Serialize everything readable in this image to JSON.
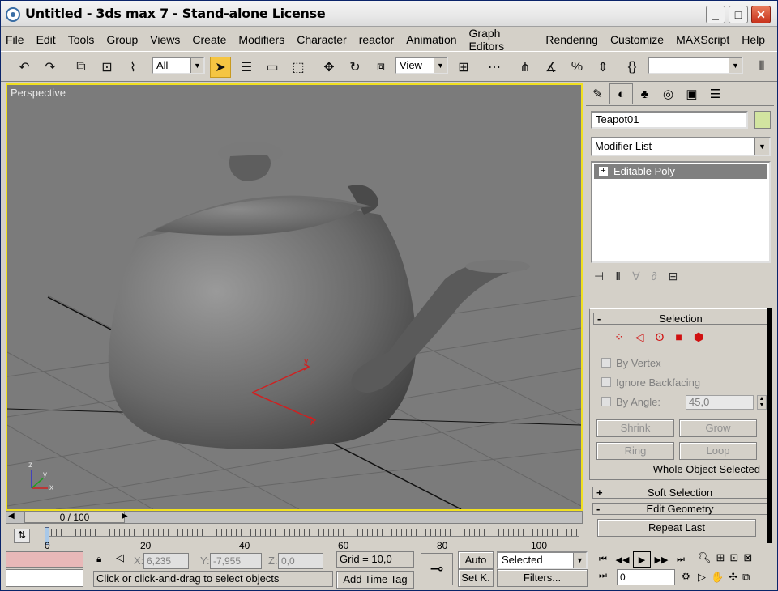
{
  "window": {
    "title": "Untitled - 3ds max 7  - Stand-alone License",
    "minimize": "_",
    "maximize": "□",
    "close": "✕"
  },
  "menu": [
    "File",
    "Edit",
    "Tools",
    "Group",
    "Views",
    "Create",
    "Modifiers",
    "Character",
    "reactor",
    "Animation",
    "Graph Editors",
    "Rendering",
    "Customize",
    "MAXScript",
    "Help"
  ],
  "toolbar": {
    "filter_value": "All",
    "coord_value": "View",
    "named_selection_value": ""
  },
  "viewport": {
    "label": "Perspective",
    "axis_x": "x",
    "axis_y": "y",
    "axis_z": "z"
  },
  "command_panel": {
    "object_name": "Teapot01",
    "object_color": "#d2e4a0",
    "modifier_list": "Modifier List",
    "stack_item": "Editable Poly",
    "selection": {
      "header": "Selection",
      "by_vertex": "By Vertex",
      "ignore_backfacing": "Ignore Backfacing",
      "by_angle": "By Angle:",
      "angle_value": "45,0",
      "shrink": "Shrink",
      "grow": "Grow",
      "ring": "Ring",
      "loop": "Loop",
      "status": "Whole Object Selected"
    },
    "soft_selection": "Soft Selection",
    "edit_geometry": "Edit Geometry",
    "repeat_last": "Repeat Last"
  },
  "timeline": {
    "slider": "0 / 100",
    "ticks": [
      "0",
      "20",
      "40",
      "60",
      "80",
      "100"
    ]
  },
  "status": {
    "x_label": "X:",
    "x_value": "6,235",
    "y_label": "Y:",
    "y_value": "-7,955",
    "z_label": "Z:",
    "z_value": "0,0",
    "grid": "Grid = 10,0",
    "prompt": "Click or click-and-drag to select objects",
    "add_time_tag": "Add Time Tag",
    "auto_key": "Auto",
    "set_key": "Set K.",
    "key_filter": "Selected",
    "filters": "Filters...",
    "frame_value": "0"
  }
}
